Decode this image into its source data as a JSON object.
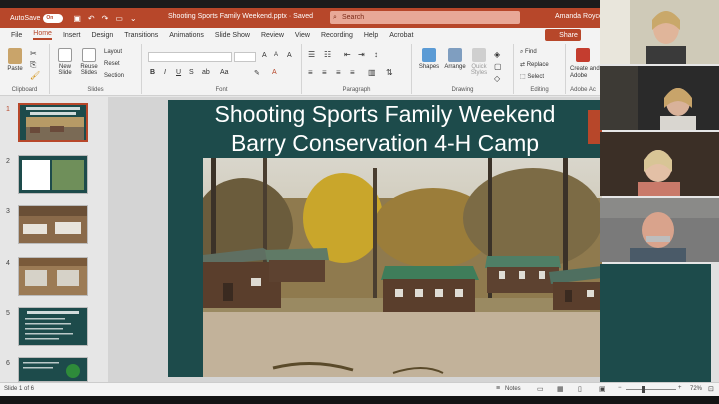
{
  "titlebar": {
    "autosave_label": "AutoSave",
    "autosave_state": "On",
    "document_title": "Shooting Sports Family Weekend.pptx  ·  Saved",
    "search_placeholder": "Search",
    "user_name": "Amanda Royce"
  },
  "menu": {
    "tabs": [
      "File",
      "Home",
      "Insert",
      "Design",
      "Transitions",
      "Animations",
      "Slide Show",
      "Review",
      "View",
      "Recording",
      "Help",
      "Acrobat"
    ],
    "share_label": "Share"
  },
  "ribbon": {
    "clipboard": {
      "label": "Clipboard",
      "paste": "Paste"
    },
    "slides": {
      "label": "Slides",
      "new_slide": "New Slide",
      "reuse_slides": "Reuse Slides",
      "layout": "Layout",
      "reset": "Reset",
      "section": "Section"
    },
    "font": {
      "label": "Font"
    },
    "paragraph": {
      "label": "Paragraph"
    },
    "drawing": {
      "label": "Drawing",
      "shapes": "Shapes",
      "arrange": "Arrange",
      "quick_styles": "Quick Styles"
    },
    "editing": {
      "label": "Editing",
      "find": "Find",
      "replace": "Replace",
      "select": "Select"
    },
    "adobe": {
      "label": "Adobe Ac",
      "create": "Create and Adobe"
    }
  },
  "thumbnails": [
    {
      "num": "1"
    },
    {
      "num": "2"
    },
    {
      "num": "3"
    },
    {
      "num": "4"
    },
    {
      "num": "5"
    },
    {
      "num": "6"
    }
  ],
  "slide": {
    "title_line1": "Shooting Sports Family Weekend",
    "title_line2": "Barry Conservation 4-H Camp"
  },
  "status": {
    "slide_indicator": "Slide 1 of 6",
    "notes_label": "Notes",
    "zoom": "72%"
  },
  "colors": {
    "accent": "#b7472a",
    "slide_bg": "#1d4b4b"
  }
}
